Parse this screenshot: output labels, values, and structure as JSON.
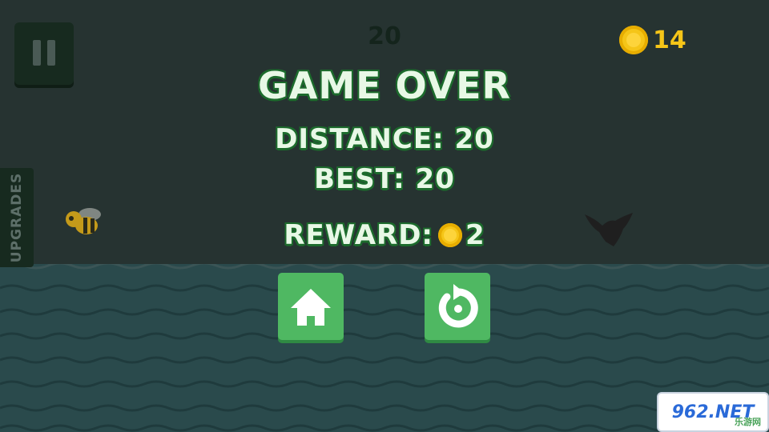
{
  "hud": {
    "score": "20",
    "coins": "14",
    "side_tab": "UPGRADES"
  },
  "game_over": {
    "title": "GAME OVER",
    "distance": "DISTANCE: 20",
    "best": "BEST: 20",
    "reward_label": "REWARD:",
    "reward_value": "2"
  },
  "icons": {
    "pause": "pause-icon",
    "coin": "coin-icon",
    "home": "home-icon",
    "retry": "retry-icon",
    "bee": "bee-sprite",
    "bat": "bat-sprite"
  },
  "watermark": {
    "main": "962.NET",
    "sub": "乐游网"
  },
  "colors": {
    "background": "#263331",
    "water": "#2a4a4c",
    "button": "#4fb862",
    "text_fill": "#e8f8e6",
    "text_outline": "#1c6b2c",
    "coin": "#f5c518"
  }
}
